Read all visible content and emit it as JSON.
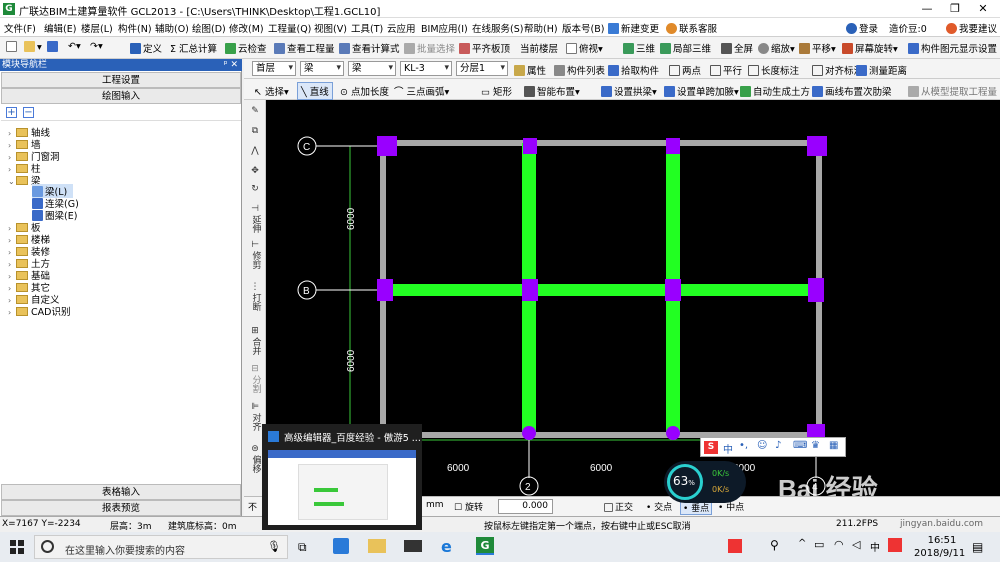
{
  "window": {
    "title": "广联达BIM土建算量软件 GCL2013 - [C:\\Users\\THINK\\Desktop\\工程1.GCL10]",
    "logo_text": "G"
  },
  "menu": {
    "items": [
      "文件(F)",
      "编辑(E)",
      "楼层(L)",
      "构件(N)",
      "辅助(O)",
      "绘图(D)",
      "修改(M)",
      "工程量(Q)",
      "视图(V)",
      "工具(T)",
      "云应用",
      "BIM应用(I)",
      "在线服务(S)",
      "帮助(H)",
      "版本号(B)",
      "新建变更",
      "联系客服"
    ],
    "right": [
      "登录",
      "造价豆:0",
      "我要建议"
    ]
  },
  "toolbar1": {
    "items": [
      "定义",
      "Σ 汇总计算",
      "云检查",
      "查看工程量",
      "查看计算式",
      "批量选择",
      "平齐板顶",
      "当前楼层",
      "俯视",
      "三维",
      "局部三维",
      "全屏",
      "缩放",
      "平移",
      "屏幕旋转",
      "构件图元显示设置"
    ]
  },
  "panel": {
    "header": "模块导航栏",
    "pin": "ᵖ ✕",
    "btn_project": "工程设置",
    "btn_draw": "绘图输入",
    "tree": [
      "轴线",
      "墙",
      "门窗洞",
      "柱",
      "梁",
      "梁(L)",
      "连梁(G)",
      "圈梁(E)",
      "板",
      "楼梯",
      "装修",
      "土方",
      "基础",
      "其它",
      "自定义",
      "CAD识别"
    ],
    "btn_table": "表格输入",
    "btn_report": "报表预览"
  },
  "toolbar2": {
    "floor": "首层",
    "type1": "梁",
    "type2": "梁",
    "component": "KL-3",
    "layer": "分层1",
    "items": [
      "属性",
      "构件列表",
      "拾取构件",
      "两点",
      "平行",
      "长度标注",
      "对齐标注",
      "测量距离"
    ]
  },
  "toolbar3": {
    "items": [
      "选择",
      "直线",
      "点加长度",
      "三点画弧",
      "矩形",
      "智能布置",
      "设置拱梁",
      "设置单跨加腋",
      "自动生成土方",
      "画线布置次肋梁",
      "从模型提取工程量"
    ]
  },
  "vtools": [
    "延伸",
    "修剪",
    "打断",
    "合并",
    "分割",
    "对齐",
    "偏移"
  ],
  "drawing": {
    "axis_labels_left": [
      "C",
      "B"
    ],
    "axis_labels_bottom": [
      "2",
      "4"
    ],
    "dim_vertical": [
      "6000",
      "6000"
    ],
    "dim_horizontal": [
      "6000",
      "6000",
      "6000"
    ],
    "colors": {
      "beam_green": "#22ff22",
      "column_purple": "#9900ff",
      "grid_gray": "#a8a8a8",
      "axis_white": "#ffffff"
    }
  },
  "statusbar2": {
    "unit": "mm",
    "rotate": "旋转",
    "rotate_val": "0.000",
    "snap": [
      "正交",
      "交点",
      "垂点",
      "中点"
    ]
  },
  "statusbar": {
    "coords": "X=7167 Y=-2234",
    "floor_height": "层高：3m",
    "base_elev": "建筑底标高：0m",
    "hint": "按鼠标左键指定第一个端点，按右键中止或ESC取消",
    "fps": "211.2FPS"
  },
  "popup": {
    "title": "高级编辑器_百度经验 - 傲游5 ..."
  },
  "meter": {
    "percent": "63",
    "unit": "%",
    "up": "0K/s",
    "down": "0K/s"
  },
  "ime": {
    "lang": "中"
  },
  "watermark": {
    "site": "jingyan.baidu.com",
    "brand": "Bai 经验"
  },
  "taskbar": {
    "search_placeholder": "在这里输入你要搜索的内容",
    "time": "16:51",
    "date": "2018/9/11",
    "tray_lang": "中"
  }
}
